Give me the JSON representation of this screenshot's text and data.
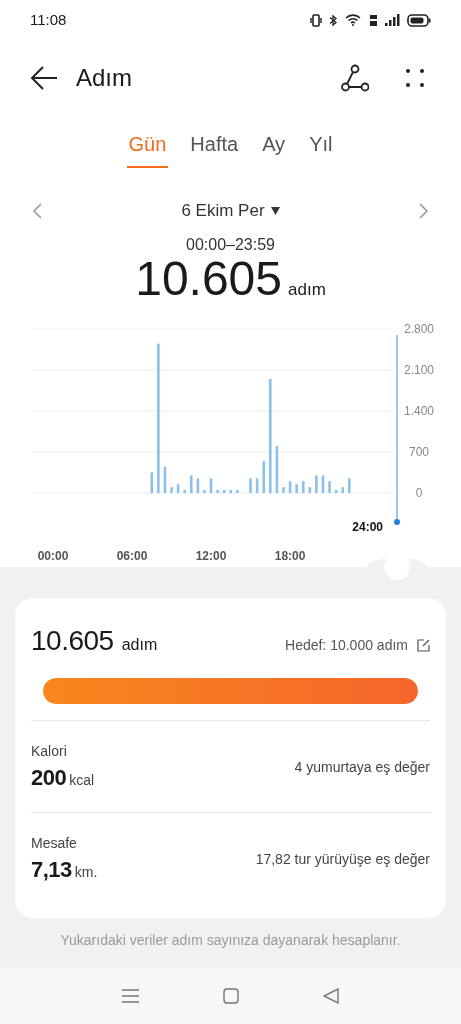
{
  "status_bar": {
    "time": "11:08"
  },
  "header": {
    "title": "Adım"
  },
  "tabs": [
    {
      "label": "Gün",
      "selected": true
    },
    {
      "label": "Hafta",
      "selected": false
    },
    {
      "label": "Ay",
      "selected": false
    },
    {
      "label": "Yıl",
      "selected": false
    }
  ],
  "date_nav": {
    "date": "6 Ekim Per",
    "range": "00:00–23:59",
    "total": "10.605",
    "unit": "adım"
  },
  "chart": {
    "cursor_label": "24:00",
    "chart_data": {
      "type": "bar",
      "x": [
        7.5,
        8,
        8.5,
        9,
        9.5,
        10,
        10.5,
        11,
        11.5,
        12,
        12.5,
        13,
        13.5,
        14,
        15,
        15.5,
        16,
        16.5,
        17,
        17.5,
        18,
        18.5,
        19,
        19.5,
        20,
        20.5,
        21,
        21.5,
        22,
        22.5
      ],
      "series": [
        {
          "color": "#8cc0ec",
          "values": [
            350,
            2550,
            450,
            100,
            150,
            50,
            300,
            250,
            50,
            250,
            50,
            50,
            50,
            50,
            250,
            250,
            550,
            1950,
            800,
            100,
            200,
            150,
            200,
            100,
            300,
            300,
            200,
            50,
            100,
            250
          ]
        }
      ],
      "xlim": [
        -1.6,
        25.8
      ],
      "ylim": [
        0,
        2800
      ],
      "grid": true,
      "yticks": [
        {
          "value": 0,
          "label": "0"
        },
        {
          "value": 700,
          "label": "700"
        },
        {
          "value": 1400,
          "label": "1.400"
        },
        {
          "value": 2100,
          "label": "2.100"
        },
        {
          "value": 2800,
          "label": "2.800"
        }
      ],
      "xticks": [
        {
          "value": 0,
          "label": "00:00"
        },
        {
          "value": 6,
          "label": "06:00"
        },
        {
          "value": 12,
          "label": "12:00"
        },
        {
          "value": 18,
          "label": "18:00"
        }
      ]
    }
  },
  "summary": {
    "steps": "10.605",
    "steps_unit": "adım",
    "goal": "Hedef: 10.000 adım",
    "level": 1
  },
  "metrics": [
    {
      "label": "Kalori",
      "value": "200",
      "unit": "kcal",
      "equivalent": "4 yumurtaya eş değer"
    },
    {
      "label": "Mesafe",
      "value": "7,13",
      "unit": "km.",
      "equivalent": "17,82 tur yürüyüşe eş değer"
    }
  ],
  "footnote": "Yukarıdaki veriler adım sayınıza dayanarak hesaplanır."
}
